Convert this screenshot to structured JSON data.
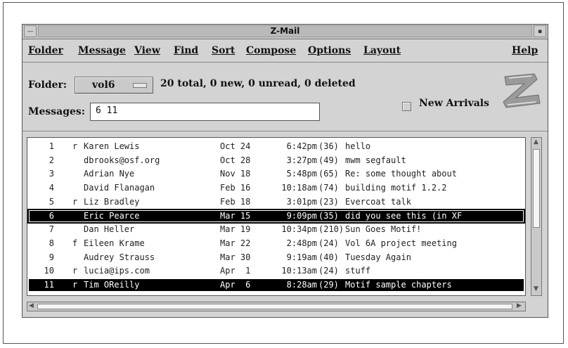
{
  "window": {
    "title": "Z-Mail"
  },
  "menu": [
    "Folder",
    "Message",
    "View",
    "Find",
    "Sort",
    "Compose",
    "Options",
    "Layout"
  ],
  "menu_help": "Help",
  "folder": {
    "label": "Folder:",
    "value": "vol6",
    "summary": "20 total, 0 new, 0 unread, 0 deleted"
  },
  "messages": {
    "label": "Messages:",
    "value": "6 11"
  },
  "new_arrivals": {
    "label": "New Arrivals",
    "checked": false
  },
  "logo_letter": "Z",
  "list": [
    {
      "num": "1",
      "status": "r",
      "from": "Karen Lewis",
      "date": "Oct 24",
      "time": "6:42pm",
      "size": "(36)",
      "subject": "hello"
    },
    {
      "num": "2",
      "status": "",
      "from": "dbrooks@osf.org",
      "date": "Oct 28",
      "time": "3:27pm",
      "size": "(49)",
      "subject": "mwm segfault"
    },
    {
      "num": "3",
      "status": "",
      "from": "Adrian Nye",
      "date": "Nov 18",
      "time": "5:48pm",
      "size": "(65)",
      "subject": "Re: some thought about"
    },
    {
      "num": "4",
      "status": "",
      "from": "David Flanagan",
      "date": "Feb 16",
      "time": "10:18am",
      "size": "(74)",
      "subject": "building motif 1.2.2"
    },
    {
      "num": "5",
      "status": "r",
      "from": "Liz Bradley",
      "date": "Feb 18",
      "time": "3:01pm",
      "size": "(23)",
      "subject": "Evercoat talk"
    },
    {
      "num": "6",
      "status": "",
      "from": "Eric Pearce",
      "date": "Mar 15",
      "time": "9:09pm",
      "size": "(35)",
      "subject": "did you see this (in XF"
    },
    {
      "num": "7",
      "status": "",
      "from": "Dan Heller",
      "date": "Mar 19",
      "time": "10:34pm",
      "size": "(210)",
      "subject": "Sun Goes Motif!"
    },
    {
      "num": "8",
      "status": "f",
      "from": "Eileen Krame",
      "date": "Mar 22",
      "time": "2:48pm",
      "size": "(24)",
      "subject": "Vol 6A project meeting"
    },
    {
      "num": "9",
      "status": "",
      "from": "Audrey Strauss",
      "date": "Mar 30",
      "time": "9:19am",
      "size": "(40)",
      "subject": "Tuesday Again"
    },
    {
      "num": "10",
      "status": "r",
      "from": "lucia@ips.com",
      "date": "Apr  1",
      "time": "10:13am",
      "size": "(24)",
      "subject": "stuff"
    },
    {
      "num": "11",
      "status": "r",
      "from": "Tim OReilly",
      "date": "Apr  6",
      "time": "8:28am",
      "size": "(29)",
      "subject": "Motif sample chapters"
    }
  ],
  "focused_row": 5,
  "selected_row": 10
}
